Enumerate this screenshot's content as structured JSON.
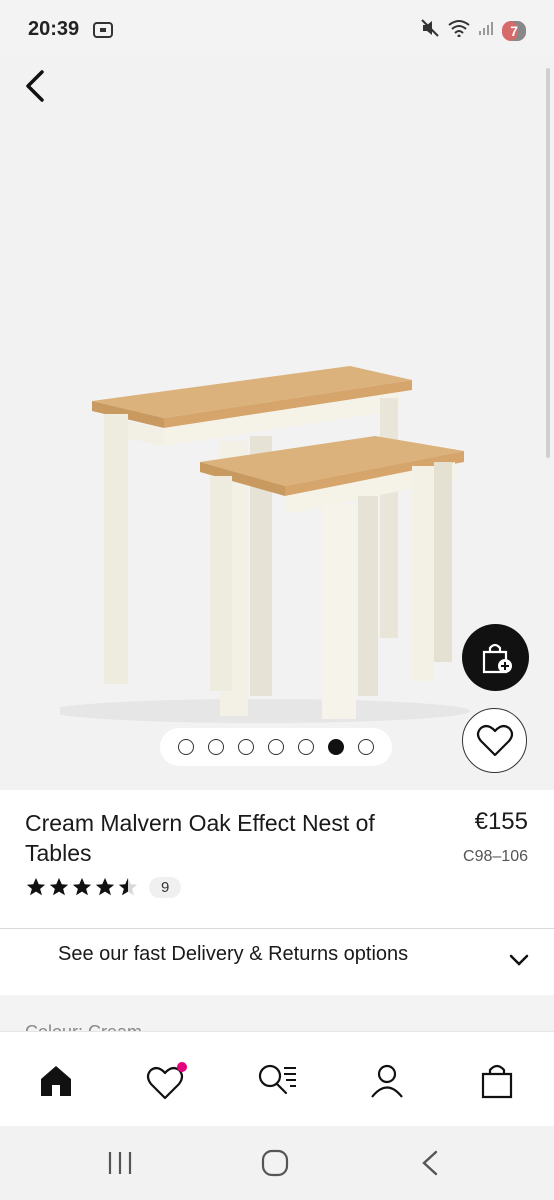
{
  "status": {
    "time": "20:39",
    "battery": "7"
  },
  "product": {
    "title": "Cream Malvern Oak Effect Nest of Tables",
    "price": "€155",
    "sku": "C98–106",
    "rating": 4.5,
    "review_count": "9",
    "image_count": 7,
    "active_image_index": 5
  },
  "delivery": {
    "label": "See our fast Delivery & Returns options"
  },
  "truncated_section": {
    "text": "Colour: Cream"
  },
  "icons": {
    "back": "chevron-left-icon",
    "add_to_bag": "bag-plus-icon",
    "wishlist": "heart-icon",
    "home": "home-icon",
    "favourites": "heart-icon",
    "search": "search-list-icon",
    "account": "person-icon",
    "bag": "shopping-bag-icon"
  },
  "colors": {
    "accent_badge": "#e5007e",
    "primary": "#111111"
  }
}
